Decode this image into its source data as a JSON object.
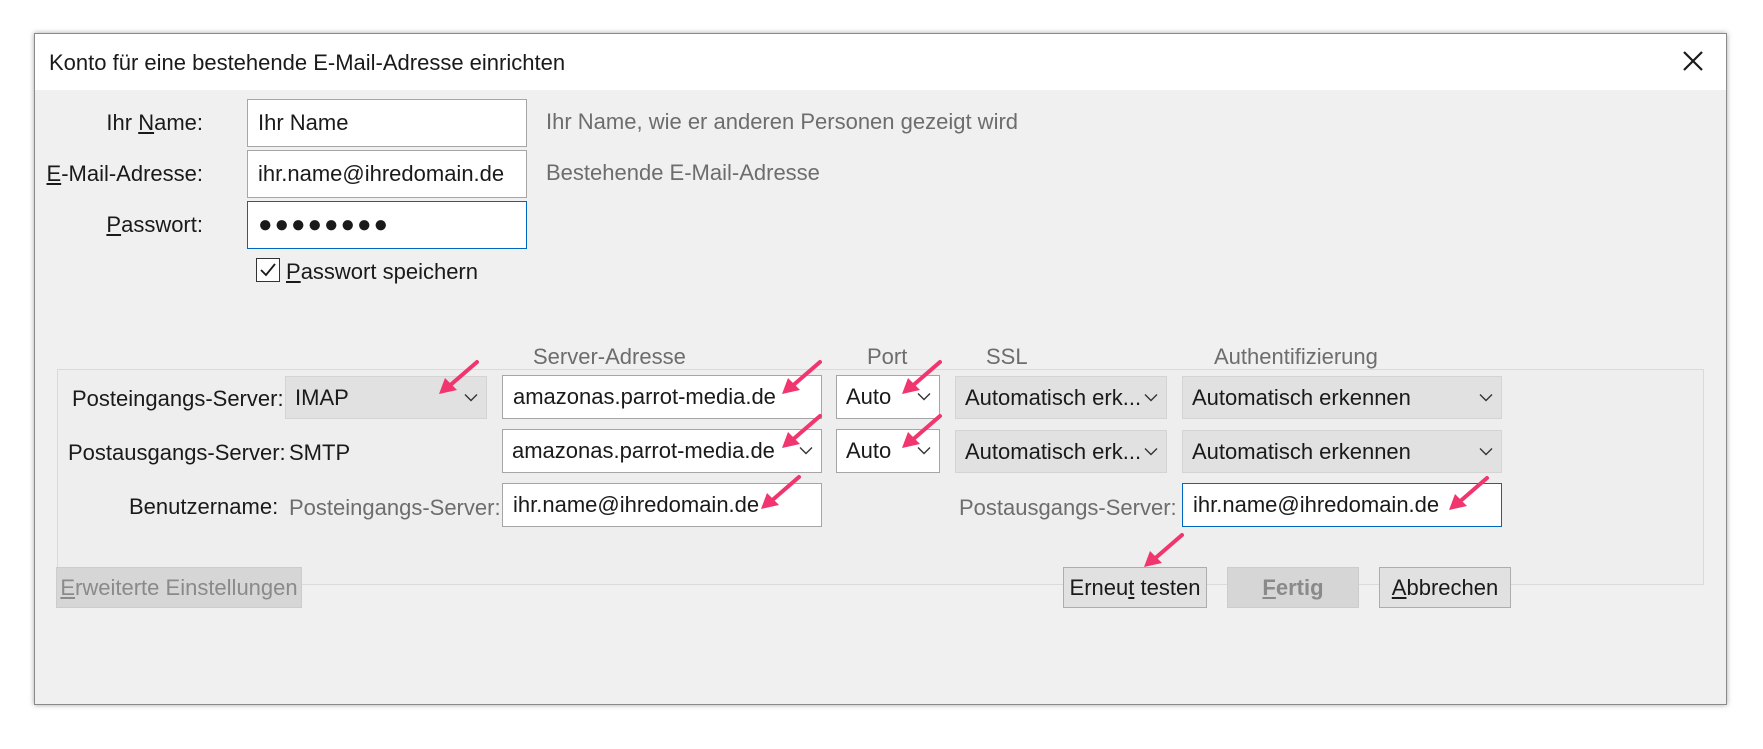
{
  "dialog": {
    "title": "Konto für eine bestehende E-Mail-Adresse einrichten"
  },
  "form": {
    "name_label_pre": "Ihr ",
    "name_label_key": "N",
    "name_label_post": "ame:",
    "name_value": "Ihr Name",
    "name_hint": "Ihr Name, wie er anderen Personen gezeigt wird",
    "email_label_key": "E",
    "email_label_post": "-Mail-Adresse:",
    "email_value": "ihr.name@ihredomain.de",
    "email_hint": "Bestehende E-Mail-Adresse",
    "password_label_key": "P",
    "password_label_post": "asswort:",
    "password_value": "●●●●●●●●",
    "remember_key": "P",
    "remember_post": "asswort speichern",
    "remember_checked": true
  },
  "server": {
    "headers": {
      "address": "Server-Adresse",
      "port": "Port",
      "ssl": "SSL",
      "auth": "Authentifizierung"
    },
    "incoming": {
      "label": "Posteingangs-Server:",
      "protocol": "IMAP",
      "address": "amazonas.parrot-media.de",
      "port": "Auto",
      "ssl": "Automatisch erk...",
      "auth": "Automatisch erkennen"
    },
    "outgoing": {
      "label": "Postausgangs-Server:",
      "protocol": "SMTP",
      "address": "amazonas.parrot-media.de",
      "port": "Auto",
      "ssl": "Automatisch erk...",
      "auth": "Automatisch erkennen"
    },
    "username": {
      "label": "Benutzername:",
      "incoming_label": "Posteingangs-Server:",
      "incoming_value": "ihr.name@ihredomain.de",
      "outgoing_label": "Postausgangs-Server:",
      "outgoing_value": "ihr.name@ihredomain.de"
    }
  },
  "buttons": {
    "advanced_key": "E",
    "advanced_post": "rweiterte Einstellungen",
    "retest_pre": "Erneu",
    "retest_key": "t",
    "retest_post": " testen",
    "done_key": "F",
    "done_post": "ertig",
    "cancel_key": "A",
    "cancel_post": "bbrechen"
  },
  "colors": {
    "annotation_arrow": "#f0356f",
    "focus_border": "#0067c0"
  },
  "icons": [
    "close-icon",
    "checkmark-icon",
    "chevron-down-icon",
    "annotation-arrow-icon"
  ]
}
